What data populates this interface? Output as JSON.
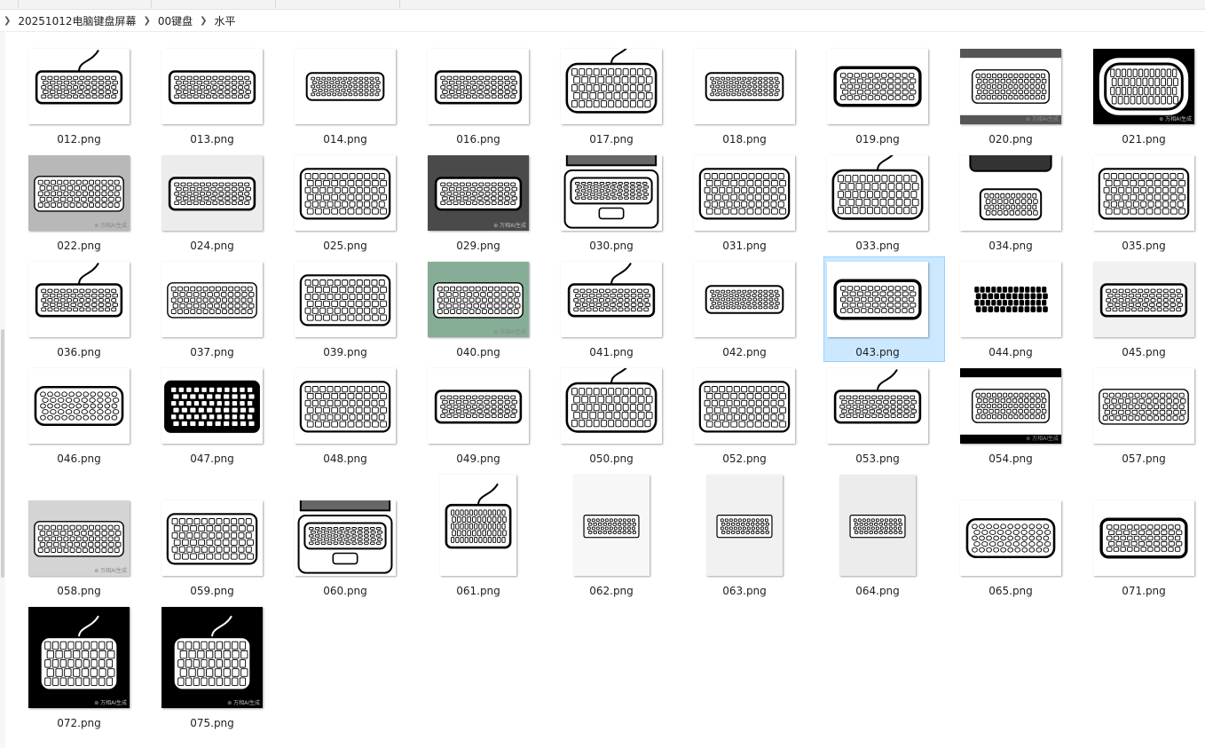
{
  "breadcrumb": {
    "items": [
      {
        "label": "20251012电脑键盘屏幕"
      },
      {
        "label": "00键盘"
      },
      {
        "label": "水平"
      }
    ]
  },
  "watermark": "⊛ 万相AI生成",
  "selected_file": "043.png",
  "files": [
    {
      "name": "012.png",
      "bg": "#ffffff",
      "style": "cable"
    },
    {
      "name": "013.png",
      "bg": "#ffffff",
      "style": "plain"
    },
    {
      "name": "014.png",
      "bg": "#ffffff",
      "style": "slim"
    },
    {
      "name": "016.png",
      "bg": "#ffffff",
      "style": "plain"
    },
    {
      "name": "017.png",
      "bg": "#ffffff",
      "style": "round-cable"
    },
    {
      "name": "018.png",
      "bg": "#ffffff",
      "style": "slim"
    },
    {
      "name": "019.png",
      "bg": "#ffffff",
      "style": "thick"
    },
    {
      "name": "020.png",
      "bg": "#ffffff",
      "style": "banded",
      "watermark": true
    },
    {
      "name": "021.png",
      "bg": "#000000",
      "style": "blob",
      "watermark": true
    },
    {
      "name": "022.png",
      "bg": "#b8b8b8",
      "style": "thin",
      "watermark": true
    },
    {
      "name": "024.png",
      "bg": "#ececec",
      "style": "plain"
    },
    {
      "name": "025.png",
      "bg": "#ffffff",
      "style": "big"
    },
    {
      "name": "029.png",
      "bg": "#4a4a4a",
      "style": "plain",
      "watermark": true
    },
    {
      "name": "030.png",
      "bg": "#ffffff",
      "style": "laptop"
    },
    {
      "name": "031.png",
      "bg": "#ffffff",
      "style": "big"
    },
    {
      "name": "033.png",
      "bg": "#ffffff",
      "style": "round-cable"
    },
    {
      "name": "034.png",
      "bg": "#ffffff",
      "style": "monitor"
    },
    {
      "name": "035.png",
      "bg": "#ffffff",
      "style": "big"
    },
    {
      "name": "036.png",
      "bg": "#ffffff",
      "style": "cable"
    },
    {
      "name": "037.png",
      "bg": "#ffffff",
      "style": "thin"
    },
    {
      "name": "039.png",
      "bg": "#ffffff",
      "style": "big"
    },
    {
      "name": "040.png",
      "bg": "#86ad95",
      "style": "thin",
      "watermark": true
    },
    {
      "name": "041.png",
      "bg": "#ffffff",
      "style": "cable"
    },
    {
      "name": "042.png",
      "bg": "#ffffff",
      "style": "slim"
    },
    {
      "name": "043.png",
      "bg": "#ffffff",
      "style": "thick"
    },
    {
      "name": "044.png",
      "bg": "#ffffff",
      "style": "keysonly"
    },
    {
      "name": "045.png",
      "bg": "#f1f1f1",
      "style": "plain"
    },
    {
      "name": "046.png",
      "bg": "#ffffff",
      "style": "round"
    },
    {
      "name": "047.png",
      "bg": "#ffffff",
      "style": "dark"
    },
    {
      "name": "048.png",
      "bg": "#ffffff",
      "style": "big"
    },
    {
      "name": "049.png",
      "bg": "#ffffff",
      "style": "plain"
    },
    {
      "name": "050.png",
      "bg": "#ffffff",
      "style": "round-cable"
    },
    {
      "name": "052.png",
      "bg": "#ffffff",
      "style": "big"
    },
    {
      "name": "053.png",
      "bg": "#ffffff",
      "style": "cable"
    },
    {
      "name": "054.png",
      "bg": "#ffffff",
      "style": "banded",
      "watermark": true
    },
    {
      "name": "057.png",
      "bg": "#ffffff",
      "style": "thin"
    },
    {
      "name": "058.png",
      "bg": "#d4d4d4",
      "style": "thin",
      "watermark": true,
      "tall": true
    },
    {
      "name": "059.png",
      "bg": "#ffffff",
      "style": "big",
      "tall": true
    },
    {
      "name": "060.png",
      "bg": "#ffffff",
      "style": "laptop",
      "tall": true
    },
    {
      "name": "061.png",
      "bg": "#ffffff",
      "style": "cable",
      "tall": true,
      "narrow": true
    },
    {
      "name": "062.png",
      "bg": "#f7f7f7",
      "style": "tiny",
      "tall": true,
      "narrow": true
    },
    {
      "name": "063.png",
      "bg": "#f1f1f1",
      "style": "tiny",
      "tall": true,
      "narrow": true
    },
    {
      "name": "064.png",
      "bg": "#ececec",
      "style": "tiny",
      "tall": true,
      "narrow": true
    },
    {
      "name": "065.png",
      "bg": "#ffffff",
      "style": "round",
      "tall": true
    },
    {
      "name": "071.png",
      "bg": "#ffffff",
      "style": "thick",
      "tall": true
    },
    {
      "name": "072.png",
      "bg": "#000000",
      "style": "dark-cable",
      "watermark": true,
      "tall": true
    },
    {
      "name": "075.png",
      "bg": "#000000",
      "style": "dark-cable",
      "watermark": true,
      "tall": true
    }
  ]
}
